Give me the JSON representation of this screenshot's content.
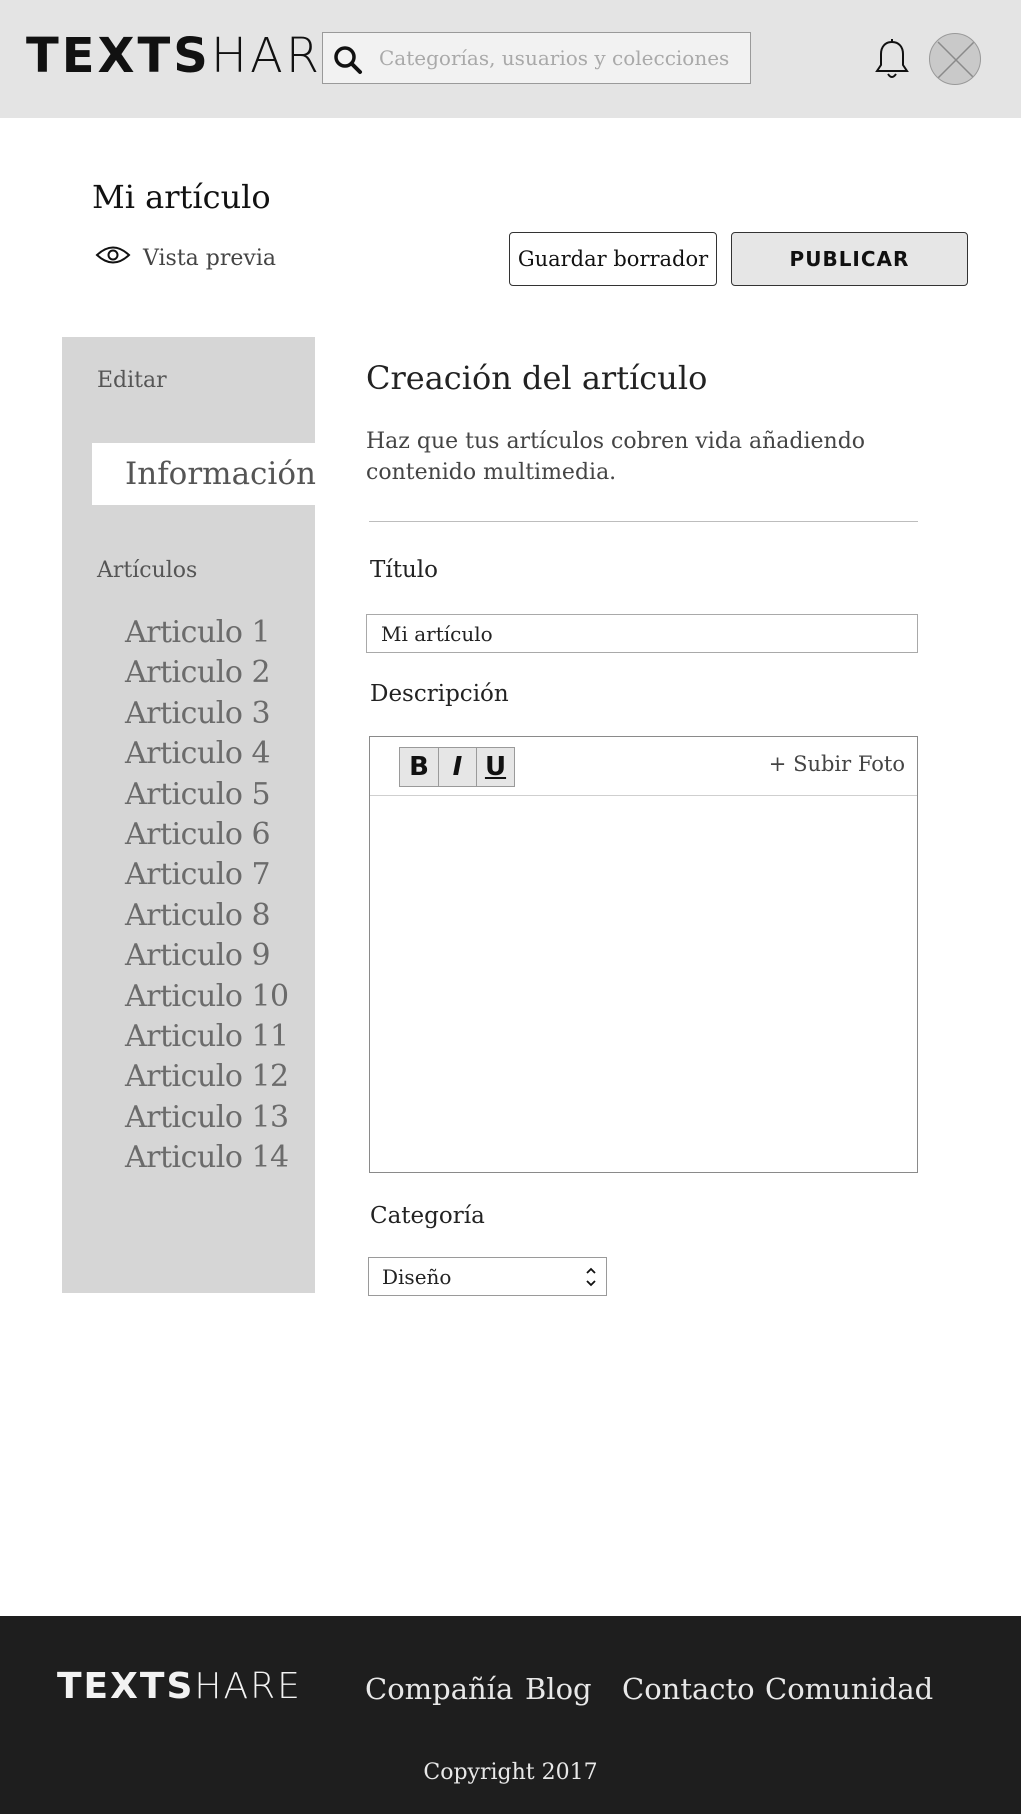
{
  "header": {
    "logo_bold": "TEXTS",
    "logo_light": "HARE",
    "search_placeholder": "Categorías, usuarios y colecciones",
    "search_icon": "search-icon",
    "notification_icon": "bell-icon",
    "avatar_icon": "avatar-placeholder"
  },
  "page": {
    "title": "Mi artículo",
    "preview_label": "Vista previa",
    "preview_icon": "eye-icon",
    "save_draft_label": "Guardar borrador",
    "publish_label": "PUBLICAR"
  },
  "sidebar": {
    "edit_heading": "Editar",
    "active_item": "Información",
    "articles_heading": "Artículos",
    "articles": [
      "Articulo 1",
      "Articulo 2",
      "Articulo 3",
      "Articulo 4",
      "Articulo 5",
      "Articulo 6",
      "Articulo 7",
      "Articulo 8",
      "Articulo 9",
      "Articulo 10",
      "Articulo 11",
      "Articulo 12",
      "Articulo 13",
      "Articulo 14"
    ]
  },
  "main": {
    "heading": "Creación del artículo",
    "description": "Haz que tus artículos cobren vida añadiendo contenido multimedia.",
    "title_label": "Título",
    "title_value": "Mi artículo",
    "description_label": "Descripción",
    "toolbar": {
      "bold": "B",
      "italic": "I",
      "underline": "U",
      "upload_photo": "+ Subir Foto"
    },
    "category_label": "Categoría",
    "category_value": "Diseño"
  },
  "footer": {
    "logo_bold": "TEXTS",
    "logo_light": "HARE",
    "links": [
      "Compañía",
      "Blog",
      "Contacto",
      "Comunidad"
    ],
    "copyright": "Copyright 2017"
  },
  "colors": {
    "header_bg": "#e4e4e4",
    "sidebar_bg": "#d6d6d6",
    "footer_bg": "#1e1e1e",
    "publish_bg": "#e6e6e6"
  }
}
